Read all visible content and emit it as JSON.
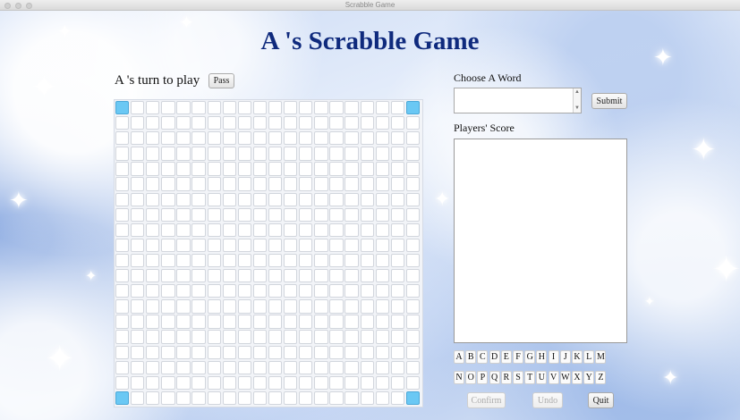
{
  "window": {
    "title": "Scrabble Game"
  },
  "header": {
    "title": "A 's Scrabble Game"
  },
  "turn": {
    "label": "A 's turn to play",
    "pass_label": "Pass"
  },
  "board": {
    "size": 20,
    "corner_color": "#6ac8f4"
  },
  "word_panel": {
    "label": "Choose A Word",
    "value": "",
    "submit_label": "Submit"
  },
  "score_panel": {
    "label": "Players' Score",
    "content": ""
  },
  "letters": {
    "row1": [
      "A",
      "B",
      "C",
      "D",
      "E",
      "F",
      "G",
      "H",
      "I",
      "J",
      "K",
      "L",
      "M"
    ],
    "row2": [
      "N",
      "O",
      "P",
      "Q",
      "R",
      "S",
      "T",
      "U",
      "V",
      "W",
      "X",
      "Y",
      "Z"
    ]
  },
  "actions": {
    "confirm_label": "Confirm",
    "undo_label": "Undo",
    "quit_label": "Quit"
  },
  "icons": {
    "scroll_up": "▲",
    "scroll_down": "▼",
    "sparkle": "✦"
  },
  "colors": {
    "title": "#0f2a7d"
  }
}
